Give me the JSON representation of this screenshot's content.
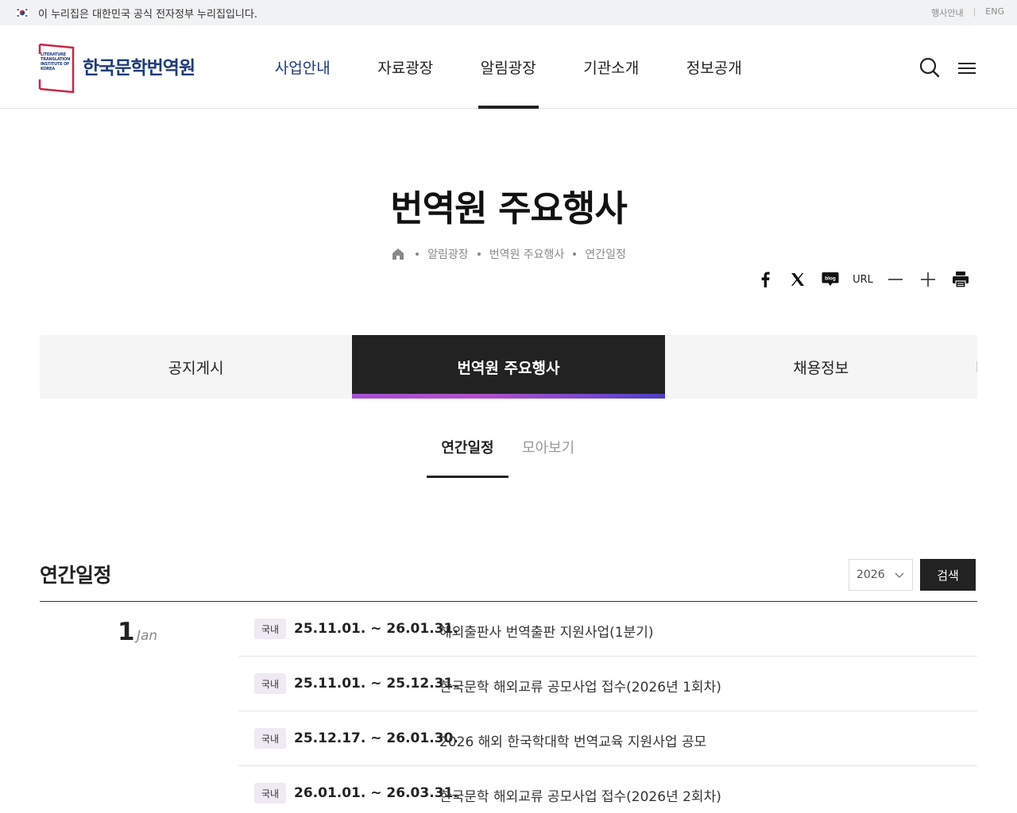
{
  "gov_banner": {
    "text": "이 누리집은 대한민국 공식 전자정부 누리집입니다.",
    "links": [
      "행사안내",
      "ENG"
    ]
  },
  "header": {
    "logo_small_text": "LITERATURE TRANSLATION INSTITUTE OF KOREA",
    "logo_name": "한국문학번역원",
    "nav": [
      "사업안내",
      "자료광장",
      "알림광장",
      "기관소개",
      "정보공개"
    ],
    "active_nav": "알림광장"
  },
  "page": {
    "title": "번역원 주요행사",
    "breadcrumb": [
      "알림광장",
      "번역원 주요행사",
      "연간일정"
    ]
  },
  "share": {
    "url_label": "URL",
    "blog_label": "blog",
    "icons": [
      "facebook-icon",
      "x-icon",
      "blog-icon",
      "url",
      "zoom-out-icon",
      "zoom-in-icon",
      "print-icon"
    ]
  },
  "tabs": [
    "공지게시",
    "번역원 주요행사",
    "채용정보"
  ],
  "active_tab": "번역원 주요행사",
  "subtabs": [
    "연간일정",
    "모아보기"
  ],
  "active_subtab": "연간일정",
  "schedule": {
    "title": "연간일정",
    "year": "2026",
    "search_label": "검색",
    "month_num": "1",
    "month_name": "Jan",
    "events": [
      {
        "badge": "국내",
        "dates": "25.11.01. ~ 26.01.31.",
        "title": "해외출판사 번역출판 지원사업(1분기)"
      },
      {
        "badge": "국내",
        "dates": "25.11.01. ~ 25.12.31.",
        "title": "한국문학 해외교류 공모사업 접수(2026년 1회차)"
      },
      {
        "badge": "국내",
        "dates": "25.12.17. ~ 26.01.30.",
        "title": "2026 해외 한국학대학 번역교육 지원사업 공모"
      },
      {
        "badge": "국내",
        "dates": "26.01.01. ~ 26.03.31.",
        "title": "한국문학 해외교류 공모사업 접수(2026년 2회차)"
      }
    ]
  },
  "colors": {
    "brand_navy": "#1f3a7a",
    "brand_red": "#c8274a",
    "dark": "#222222",
    "badge_bg": "#eee9f3"
  }
}
